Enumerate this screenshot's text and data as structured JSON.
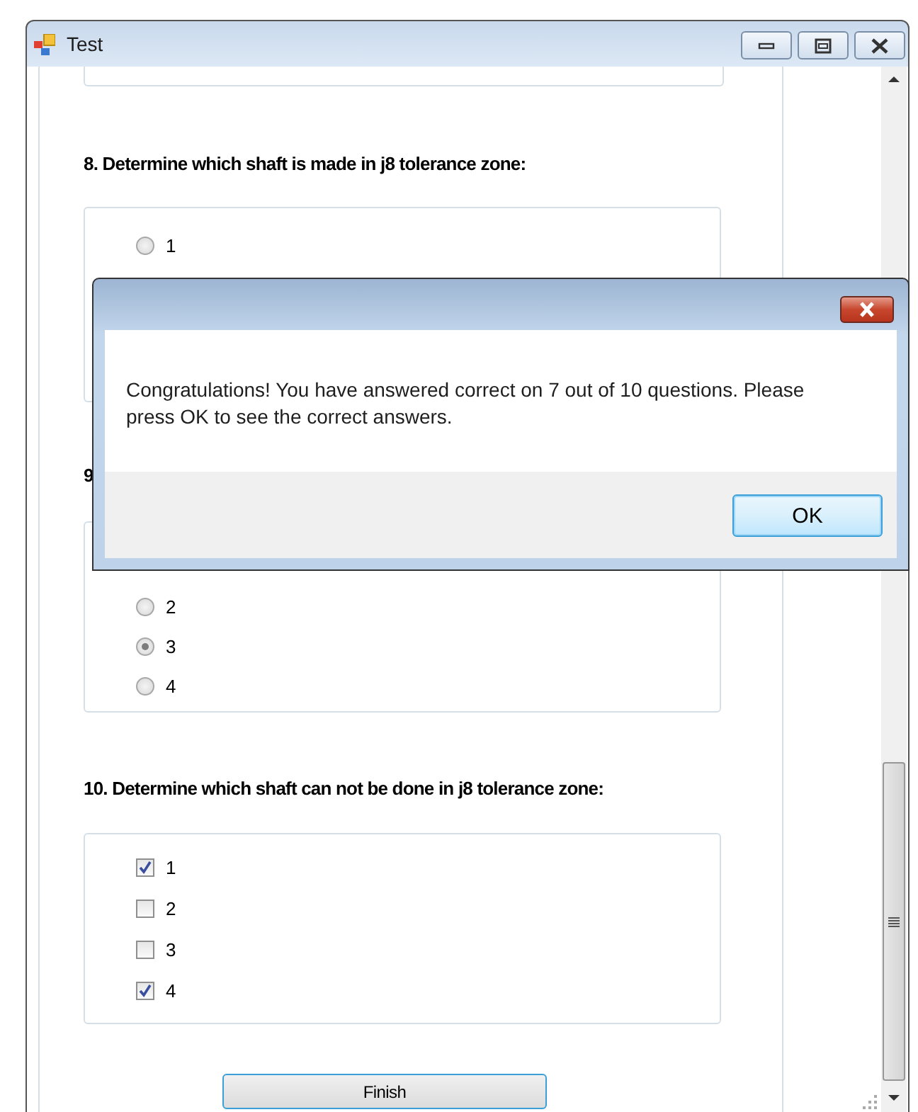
{
  "window": {
    "title": "Test"
  },
  "questions": [
    {
      "title": "8. Determine which shaft is made in j8 tolerance zone:",
      "kind": "radio",
      "options": [
        {
          "label": "1",
          "selected": false
        }
      ]
    },
    {
      "title": "9",
      "kind": "radio",
      "options": [
        {
          "label": "2",
          "selected": false
        },
        {
          "label": "3",
          "selected": true
        },
        {
          "label": "4",
          "selected": false
        }
      ]
    },
    {
      "title": "10. Determine which shaft can not be done in j8 tolerance zone:",
      "kind": "checkbox",
      "options": [
        {
          "label": "1",
          "checked": true
        },
        {
          "label": "2",
          "checked": false
        },
        {
          "label": "3",
          "checked": false
        },
        {
          "label": "4",
          "checked": true
        }
      ]
    }
  ],
  "finish_button": "Finish",
  "dialog": {
    "message": "Congratulations! You have answered correct on 7 out of 10 questions. Please press OK to see the correct answers.",
    "button": "OK"
  }
}
